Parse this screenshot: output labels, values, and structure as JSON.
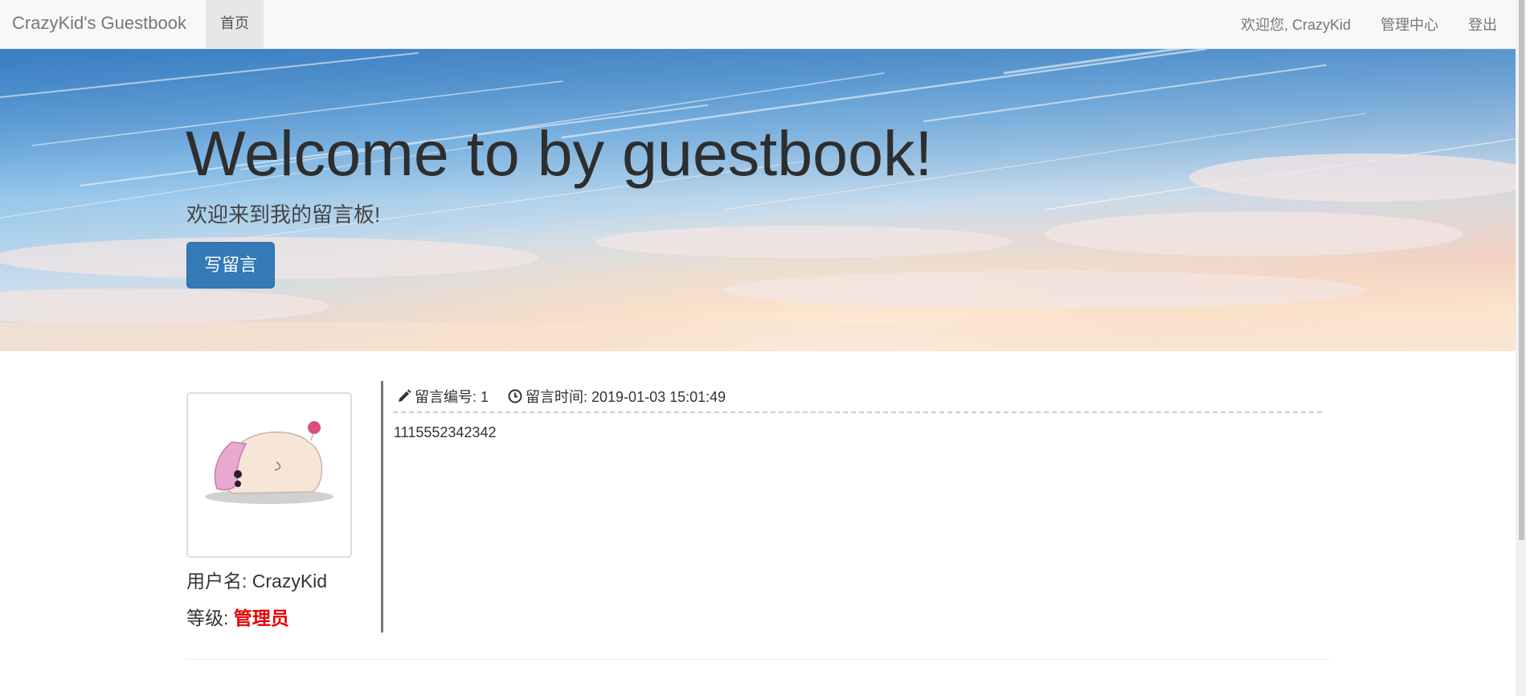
{
  "navbar": {
    "brand": "CrazyKid's Guestbook",
    "home": "首页",
    "welcome": "欢迎您, CrazyKid",
    "admin": "管理中心",
    "logout": "登出"
  },
  "jumbotron": {
    "title": "Welcome to by guestbook!",
    "subtitle": "欢迎来到我的留言板!",
    "button_label": "写留言"
  },
  "message": {
    "id_label": "留言编号: 1",
    "time_label": "留言时间: 2019-01-03 15:01:49",
    "content": "1115552342342",
    "author": {
      "username_label": "用户名: CrazyKid",
      "role_prefix": "等级: ",
      "role_value": "管理员"
    }
  },
  "colors": {
    "primary_button": "#337ab7",
    "role_color": "#e60000",
    "navbar_bg": "#f8f8f8"
  },
  "icons": {
    "message_id": "pencil-icon",
    "message_time": "clock-icon"
  }
}
